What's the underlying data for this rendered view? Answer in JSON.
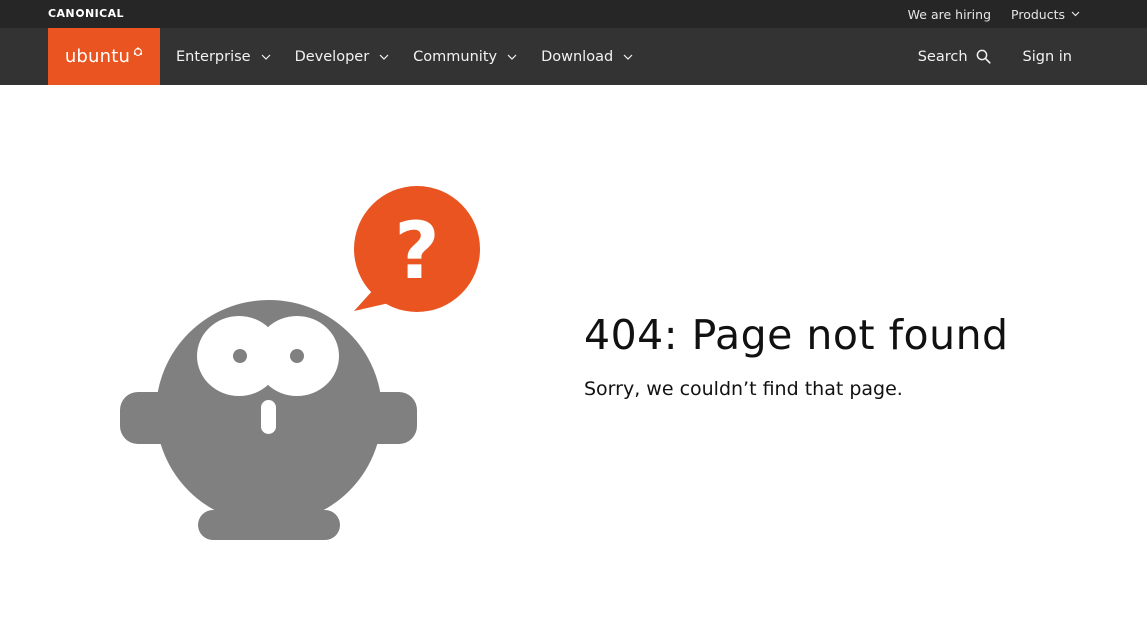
{
  "topbar": {
    "logo_before": "CAN",
    "logo_after": "NICAL",
    "links": [
      {
        "label": "We are hiring"
      },
      {
        "label": "Products"
      }
    ]
  },
  "navbar": {
    "brand": "ubuntu",
    "items": [
      {
        "label": "Enterprise"
      },
      {
        "label": "Developer"
      },
      {
        "label": "Community"
      },
      {
        "label": "Download"
      }
    ],
    "search_label": "Search",
    "signin_label": "Sign in"
  },
  "error": {
    "title": "404: Page not found",
    "message": "Sorry, we couldn’t find that page.",
    "bubble_glyph": "?"
  },
  "colors": {
    "brand_orange": "#e95420",
    "topbar_bg": "#262626",
    "navbar_bg": "#333333",
    "mascot_grey": "#808080"
  },
  "icons": {
    "chevron": "chevron-down-icon",
    "search": "search-icon",
    "circle_of_friends": "circle-of-friends-icon"
  }
}
